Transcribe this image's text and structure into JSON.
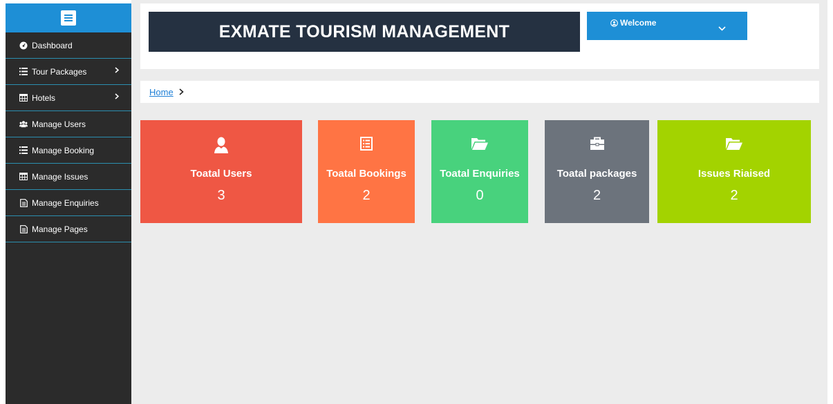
{
  "sidebar": {
    "items": [
      {
        "label": "Dashboard",
        "icon": "dashboard-icon",
        "has_submenu": false
      },
      {
        "label": "Tour Packages",
        "icon": "list-icon",
        "has_submenu": true
      },
      {
        "label": "Hotels",
        "icon": "table-icon",
        "has_submenu": true
      },
      {
        "label": "Manage Users",
        "icon": "users-icon",
        "has_submenu": false
      },
      {
        "label": "Manage Booking",
        "icon": "list-icon",
        "has_submenu": false
      },
      {
        "label": "Manage Issues",
        "icon": "table-icon",
        "has_submenu": false
      },
      {
        "label": "Manage Enquiries",
        "icon": "file-text-icon",
        "has_submenu": false
      },
      {
        "label": "Manage Pages",
        "icon": "file-text-icon",
        "has_submenu": false
      }
    ]
  },
  "header": {
    "title": "EXMATE TOURISM MANAGEMENT",
    "welcome_label": "Welcome"
  },
  "breadcrumb": {
    "home": "Home"
  },
  "cards": [
    {
      "label": "Toatal Users",
      "value": "3",
      "icon": "user-icon",
      "color": "#ef5744"
    },
    {
      "label": "Toatal Bookings",
      "value": "2",
      "icon": "list-box-icon",
      "color": "#ff7444"
    },
    {
      "label": "Toatal Enquiries",
      "value": "0",
      "icon": "folder-open-icon",
      "color": "#48d27d"
    },
    {
      "label": "Toatal packages",
      "value": "2",
      "icon": "briefcase-icon",
      "color": "#6c737c"
    },
    {
      "label": "Issues Riaised",
      "value": "2",
      "icon": "folder-open-icon",
      "color": "#a3d300"
    }
  ],
  "colors": {
    "sidebar_bg": "#2b2b2b",
    "accent_blue": "#1e8fd6",
    "title_bg": "#253141",
    "page_bg": "#ececec"
  }
}
